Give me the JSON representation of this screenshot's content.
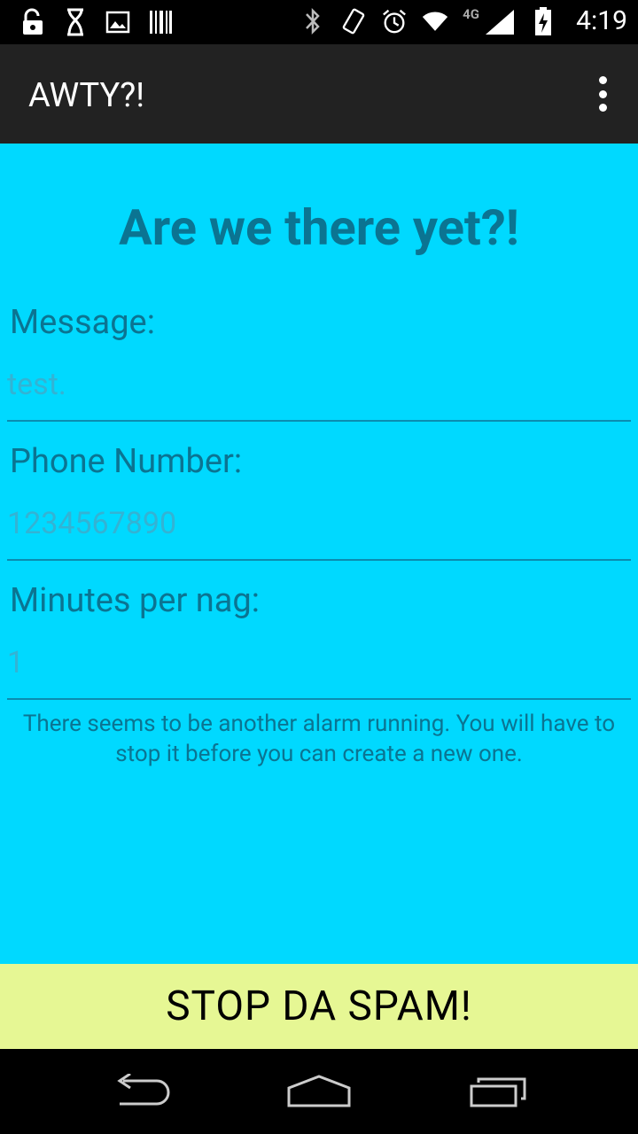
{
  "status_bar": {
    "time": "4:19",
    "network": "4G",
    "left_icons": [
      "unlock-icon",
      "hourglass-icon",
      "image-icon",
      "barcode-icon"
    ],
    "right_icons": [
      "bluetooth-icon",
      "vibrate-icon",
      "alarm-icon",
      "wifi-icon",
      "signal-icon",
      "battery-charging-icon"
    ]
  },
  "app_bar": {
    "title": "AWTY?!"
  },
  "main": {
    "heading": "Are we there yet?!",
    "fields": [
      {
        "label": "Message:",
        "value": "test."
      },
      {
        "label": "Phone Number:",
        "value": "1234567890"
      },
      {
        "label": "Minutes per nag:",
        "value": "1"
      }
    ],
    "notice": "There seems to be another alarm running. You will have to stop it before you can create a new one."
  },
  "action": {
    "stop_label": "STOP DA SPAM!"
  },
  "nav_bar": {
    "buttons": [
      "back-icon",
      "home-icon",
      "recents-icon"
    ]
  },
  "colors": {
    "content_bg": "#00D9FF",
    "text": "#0B7492",
    "button_bg": "#E6F794",
    "app_bar_bg": "#222222"
  }
}
